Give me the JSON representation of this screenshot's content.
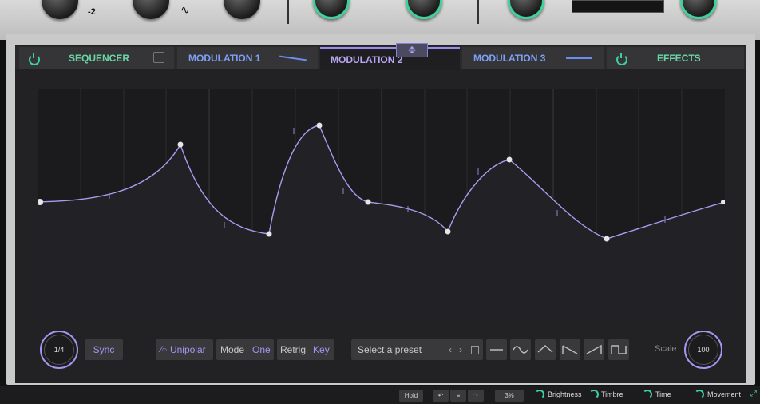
{
  "tabs": [
    {
      "label": "SEQUENCER"
    },
    {
      "label": "MODULATION 1"
    },
    {
      "label": "MODULATION 2"
    },
    {
      "label": "MODULATION 3"
    },
    {
      "label": "EFFECTS"
    }
  ],
  "top": {
    "knob_label": "-2"
  },
  "controls": {
    "rate_value": "1/4",
    "sync_label": "Sync",
    "unipolar_label": "Unipolar",
    "mode_label": "Mode",
    "mode_value": "One",
    "retrig_label": "Retrig",
    "retrig_value": "Key",
    "preset_placeholder": "Select a preset",
    "scale_label": "Scale",
    "scale_value": "100"
  },
  "status": {
    "hold_label": "Hold",
    "zoom_value": "3%",
    "macros": [
      "Brightness",
      "Timbre",
      "Time",
      "Movement"
    ]
  },
  "icons": [
    "power-icon",
    "lock-icon",
    "move-icon",
    "sine-wave-icon",
    "triangle-wave-icon",
    "saw-wave-icon",
    "ramp-wave-icon",
    "square-wave-icon",
    "flat-wave-icon",
    "undo-icon",
    "redo-icon",
    "menu-icon",
    "copy-icon",
    "resize-icon"
  ],
  "colors": {
    "accent_green": "#3fd19a",
    "accent_purple": "#a694f0",
    "mod_blue": "#6b8df0"
  }
}
